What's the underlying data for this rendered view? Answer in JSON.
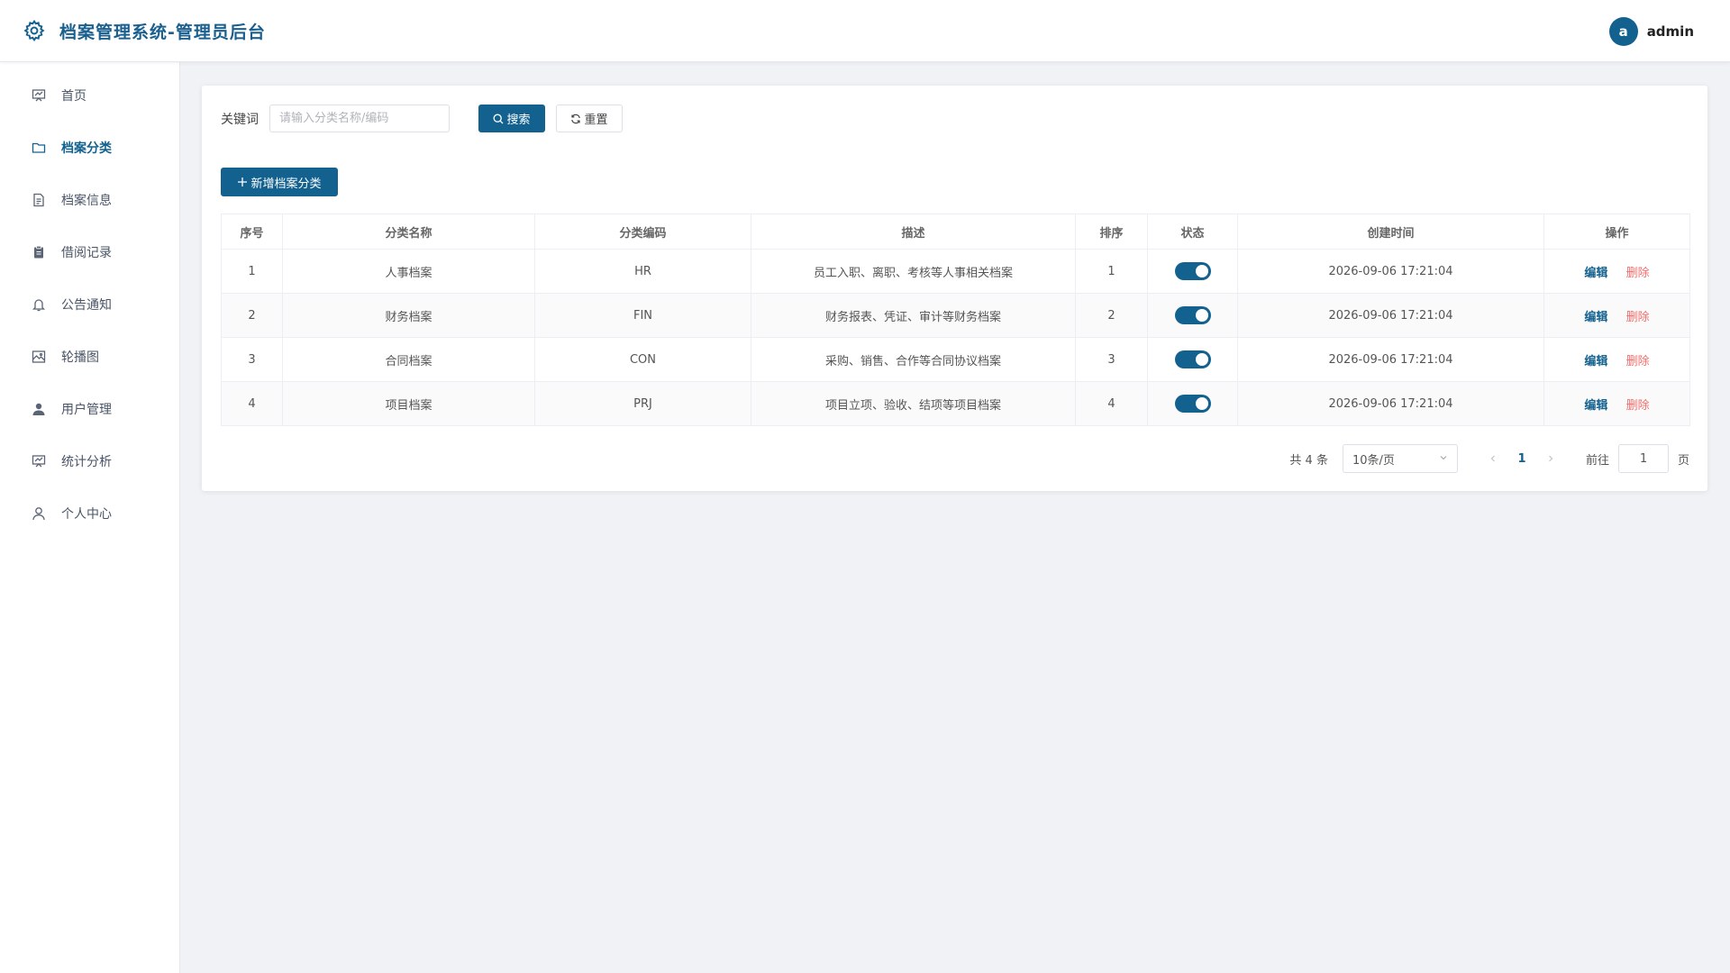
{
  "header": {
    "title": "档案管理系统-管理员后台",
    "user_avatar_letter": "a",
    "username": "admin",
    "accent_color": "#13618f"
  },
  "sidebar": {
    "items": [
      {
        "label": "首页",
        "icon": "presentation-board-icon",
        "active": false
      },
      {
        "label": "档案分类",
        "icon": "folder-icon",
        "active": true
      },
      {
        "label": "档案信息",
        "icon": "document-icon",
        "active": false
      },
      {
        "label": "借阅记录",
        "icon": "clipboard-icon",
        "active": false
      },
      {
        "label": "公告通知",
        "icon": "bell-icon",
        "active": false
      },
      {
        "label": "轮播图",
        "icon": "picture-icon",
        "active": false
      },
      {
        "label": "用户管理",
        "icon": "user-filled-icon",
        "active": false
      },
      {
        "label": "统计分析",
        "icon": "chart-board-icon",
        "active": false
      },
      {
        "label": "个人中心",
        "icon": "user-outline-icon",
        "active": false
      }
    ]
  },
  "filter": {
    "keyword_label": "关键词",
    "keyword_placeholder": "请输入分类名称/编码",
    "keyword_value": "",
    "search_label": "搜索",
    "reset_label": "重置"
  },
  "add_button_label": "新增档案分类",
  "table": {
    "columns": [
      "序号",
      "分类名称",
      "分类编码",
      "描述",
      "排序",
      "状态",
      "创建时间",
      "操作"
    ],
    "rows": [
      {
        "index": "1",
        "name": "人事档案",
        "code": "HR",
        "desc": "员工入职、离职、考核等人事相关档案",
        "sort": "1",
        "enabled": true,
        "created": "2026-09-06 17:21:04"
      },
      {
        "index": "2",
        "name": "财务档案",
        "code": "FIN",
        "desc": "财务报表、凭证、审计等财务档案",
        "sort": "2",
        "enabled": true,
        "created": "2026-09-06 17:21:04"
      },
      {
        "index": "3",
        "name": "合同档案",
        "code": "CON",
        "desc": "采购、销售、合作等合同协议档案",
        "sort": "3",
        "enabled": true,
        "created": "2026-09-06 17:21:04"
      },
      {
        "index": "4",
        "name": "项目档案",
        "code": "PRJ",
        "desc": "项目立项、验收、结项等项目档案",
        "sort": "4",
        "enabled": true,
        "created": "2026-09-06 17:21:04"
      }
    ],
    "edit_label": "编辑",
    "delete_label": "删除"
  },
  "pagination": {
    "total_text": "共 4 条",
    "page_size": "10条/页",
    "current_page": "1",
    "goto_label": "前往",
    "goto_value": "1",
    "page_unit": "页"
  }
}
